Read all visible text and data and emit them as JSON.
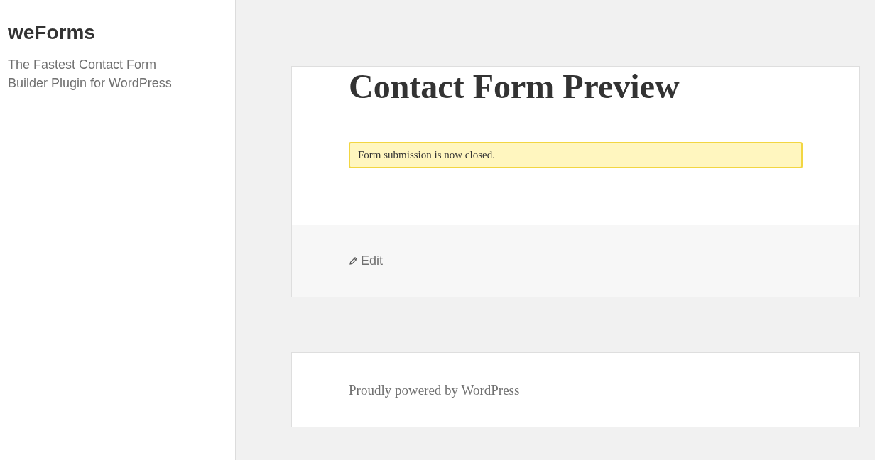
{
  "site": {
    "title": "weForms",
    "tagline": "The Fastest Contact Form Builder Plugin for WordPress"
  },
  "article": {
    "title": "Contact Form Preview",
    "notice": "Form submission is now closed.",
    "edit_link": "Edit"
  },
  "footer": {
    "credit": "Proudly powered by WordPress"
  }
}
